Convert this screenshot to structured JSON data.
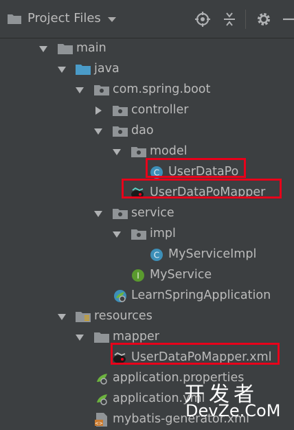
{
  "toolbar": {
    "title": "Project Files",
    "icons": [
      "folder-icon",
      "dropdown-icon",
      "locate-icon",
      "collapse-icon",
      "settings-icon",
      "minimize-icon"
    ]
  },
  "tree": [
    {
      "label": "main",
      "icon": "folder-icon"
    },
    {
      "label": "java",
      "icon": "source-folder-icon"
    },
    {
      "label": "com.spring.boot",
      "icon": "package-icon"
    },
    {
      "label": "controller",
      "icon": "package-icon"
    },
    {
      "label": "dao",
      "icon": "package-icon"
    },
    {
      "label": "model",
      "icon": "package-icon"
    },
    {
      "label": "UserDataPo",
      "icon": "class-icon",
      "highlighted": true
    },
    {
      "label": "UserDataPoMapper",
      "icon": "mybatis-mapper-icon",
      "highlighted": true
    },
    {
      "label": "service",
      "icon": "package-icon"
    },
    {
      "label": "impl",
      "icon": "package-icon"
    },
    {
      "label": "MyServiceImpl",
      "icon": "class-icon"
    },
    {
      "label": "MyService",
      "icon": "interface-icon"
    },
    {
      "label": "LearnSpringApplication",
      "icon": "spring-boot-class-icon"
    },
    {
      "label": "resources",
      "icon": "resources-folder-icon"
    },
    {
      "label": "mapper",
      "icon": "folder-icon"
    },
    {
      "label": "UserDataPoMapper.xml",
      "icon": "mybatis-xml-icon",
      "highlighted": true
    },
    {
      "label": "application.properties",
      "icon": "spring-properties-icon"
    },
    {
      "label": "application.yml",
      "icon": "spring-yml-icon"
    },
    {
      "label": "mybatis-generator.xml",
      "icon": "xml-file-icon"
    }
  ],
  "watermark": {
    "line1": "开发者",
    "line2": "DevZe.CoM"
  },
  "colors": {
    "background": "#3c3f41",
    "text": "#bbbbbb",
    "highlight": "#e8001a",
    "folder": "#909497",
    "source_folder": "#4a9bc8",
    "class": "#3d8fb8",
    "interface": "#5a9a2e",
    "spring": "#6db33f"
  }
}
